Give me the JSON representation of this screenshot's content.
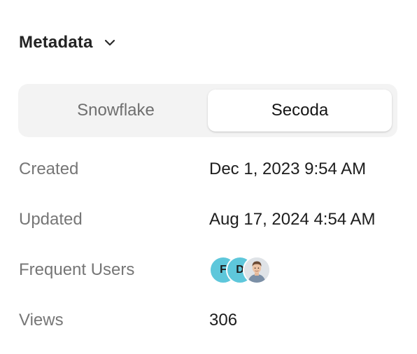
{
  "metadata": {
    "title": "Metadata",
    "toggle_icon": "chevron-down-icon"
  },
  "source_tabs": [
    {
      "label": "Snowflake",
      "active": false
    },
    {
      "label": "Secoda",
      "active": true
    }
  ],
  "fields": {
    "created": {
      "label": "Created",
      "value": "Dec 1, 2023 9:54 AM"
    },
    "updated": {
      "label": "Updated",
      "value": "Aug 17, 2024 4:54 AM"
    },
    "frequent_users": {
      "label": "Frequent Users",
      "users": [
        {
          "initial": "F",
          "color": "#5ec7db"
        },
        {
          "initial": "D",
          "color": "#5ec7db"
        },
        {
          "initial": "",
          "photo": true
        }
      ]
    },
    "views": {
      "label": "Views",
      "value": "306"
    }
  }
}
